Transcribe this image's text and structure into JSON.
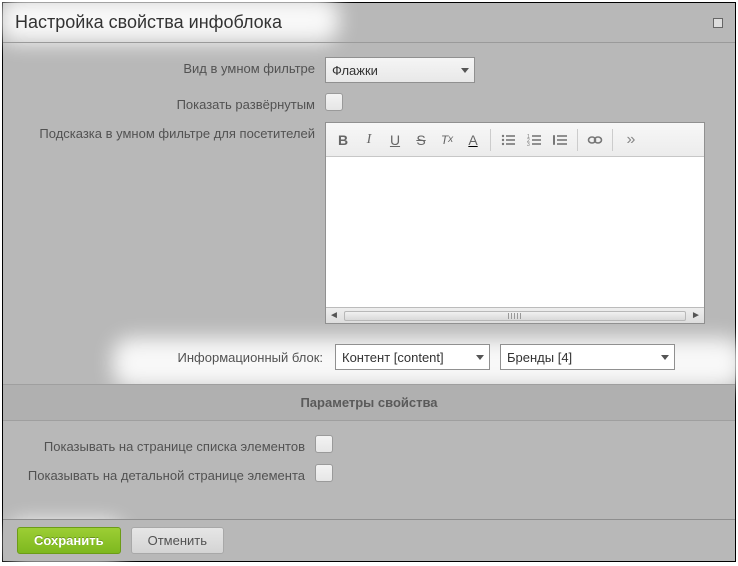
{
  "dialog": {
    "title": "Настройка свойства инфоблока"
  },
  "form": {
    "smart_filter_view": {
      "label": "Вид в умном фильтре",
      "value": "Флажки"
    },
    "show_expanded": {
      "label": "Показать развёрнутым"
    },
    "hint": {
      "label": "Подсказка в умном фильтре для посетителей"
    },
    "info_block": {
      "label": "Информационный блок:",
      "type_value": "Контент [content]",
      "iblock_value": "Бренды [4]"
    }
  },
  "section": {
    "params_header": "Параметры свойства",
    "show_on_list": {
      "label": "Показывать на странице списка элементов"
    },
    "show_on_detail": {
      "label": "Показывать на детальной странице элемента"
    }
  },
  "footer": {
    "save": "Сохранить",
    "cancel": "Отменить"
  },
  "rte_icons": [
    "B",
    "I",
    "U",
    "S",
    "Tx",
    "A",
    "list-ul",
    "list-ol",
    "blockquote",
    "link",
    "more"
  ]
}
